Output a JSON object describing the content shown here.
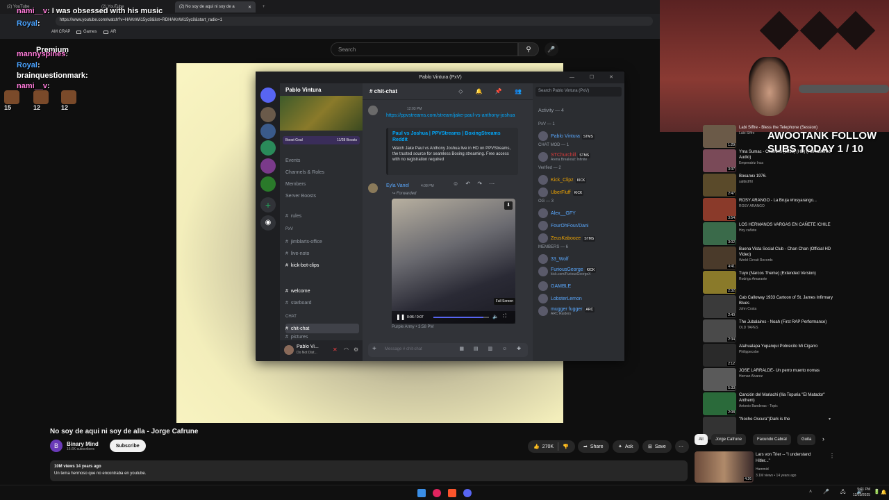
{
  "browser": {
    "tabs": [
      "(2) YouTube",
      "(2) YouTube",
      "(2) No soy de aqui ni soy de a"
    ],
    "url": "https://www.youtube.com/watch?v=HAKnWi15yc8&list=RDHAKnWi15yc8&start_radio=1",
    "bookmarks": [
      "AM CRAP",
      "Games",
      "AR"
    ]
  },
  "chat_overlay": [
    {
      "user": "nami__v",
      "text": ": I was obsessed with his music",
      "color": "#ff7ad9"
    },
    {
      "user": "Royal",
      "text": ":",
      "color": "#4aa3ff"
    },
    {
      "user": "",
      "text": "Premium",
      "color": "#fff"
    },
    {
      "user": "mannyspines",
      "text": ":",
      "color": "#ff7ad9"
    },
    {
      "user": "Royal",
      "text": ":",
      "color": "#4aa3ff"
    },
    {
      "user": "brainquestionmark",
      "text": ":",
      "color": "#fff"
    },
    {
      "user": "nami__v",
      "text": ":",
      "color": "#ff7ad9"
    }
  ],
  "chat_counts": [
    "15",
    "12",
    "12"
  ],
  "youtube": {
    "search_placeholder": "Search",
    "title": "No soy de aqui ni soy de alla - Jorge Cafrune",
    "channel": "Binary Mind",
    "subscribers": "15.6K subscribers",
    "subscribe": "Subscribe",
    "likes": "270K",
    "share": "Share",
    "ask": "Ask",
    "save": "Save",
    "views_line": "10M views  14 years ago",
    "description": "Un tema hermoso que no encontraba en youtube.",
    "chips": [
      "All",
      "Jorge Cafrune",
      "Facundo Cabral",
      "Guita"
    ]
  },
  "discord": {
    "window_title": "Pablo Vintura (PxV)",
    "server_name": "Pablo Vintura",
    "boost_goal": "Boost Goal",
    "boosts": "11/28 Boosts",
    "menu": [
      "Events",
      "Channels & Roles",
      "Members",
      "Server Boosts"
    ],
    "rules": "rules",
    "cat_pxv": "PxV",
    "channels_pxv": [
      "jimblarts-office",
      "live-noto",
      "kick-bot-clips"
    ],
    "channels_misc": [
      "welcome",
      "starboard"
    ],
    "cat_chat": "CHAT",
    "channels_chat": [
      "chit-chat",
      "pictures"
    ],
    "user_name": "Pablo Vi...",
    "user_status": "Do Not Dist...",
    "chat_channel": "chit-chat",
    "search_placeholder": "Search Pablo Vintura (PxV)",
    "msg_time": "12:03 PM",
    "msg_link": "https://ppvstreams.com/stream/jake-paul-vs-anthony-joshua",
    "embed_title": "Paul vs Joshua | PPVStreams | BoxingStreams Reddit",
    "embed_body": "Watch Jake Paul vs Anthony Joshua live in HD on PPVStreams, the trusted source for seamless Boxing streaming. Free access with no registration required",
    "msg2_user": "Eyla Vanel",
    "msg2_time": "4:08 PM",
    "forwarded": "Forwarded",
    "video_time": "0:06 / 0:07",
    "tooltip": "Full Screen",
    "source": "Purple Army • 3:58 PM",
    "composer_placeholder": "Message # chit-chat",
    "activity": "Activity — 4",
    "members": [
      {
        "section": "PxV — 1"
      },
      {
        "name": "Pablo Vintura",
        "color": "#5aa9ff",
        "tag": "STMS"
      },
      {
        "section": "CHAT MOD — 1"
      },
      {
        "name": "STChurchill",
        "color": "#e03c3c",
        "tag": "STMS",
        "sub": "Arena Breakout: Infinite"
      },
      {
        "section": "Verified — 2"
      },
      {
        "name": "Kick_Clipz",
        "color": "#f0a500",
        "tag": "KICK"
      },
      {
        "name": "UberFluff",
        "color": "#f0a500",
        "tag": "KICK"
      },
      {
        "section": "OG — 3"
      },
      {
        "name": "Alex__GFY",
        "color": "#5aa9ff"
      },
      {
        "name": "FourOhFour/Dani",
        "color": "#5aa9ff"
      },
      {
        "name": "ZeusKabooze",
        "color": "#f0a500",
        "tag": "STMS"
      },
      {
        "section": "MEMBERS — 6"
      },
      {
        "name": "33_Wolf",
        "color": "#5aa9ff"
      },
      {
        "name": "FuriousGeorge",
        "color": "#5aa9ff",
        "tag": "KICK",
        "sub": "kick.com/FuriousGeorgeX"
      },
      {
        "name": "GAMBLE",
        "color": "#5aa9ff"
      },
      {
        "name": "LobsterLemon",
        "color": "#5aa9ff"
      },
      {
        "name": "mugger fugger",
        "color": "#5aa9ff",
        "tag": "ARC",
        "sub": "ARC Raiders"
      }
    ]
  },
  "sub_goal": "AWOOTANK FOLLOW\nSUBS TODAY 1 / 10",
  "related": [
    {
      "title": "Labi Siffre - Bless the Telephone (Session)",
      "channel": "Labi Siffre",
      "dur": "1:29",
      "color": "#6b5a48"
    },
    {
      "title": "Yma Sumac - Chuncho (1958) (HD) (Remastered Audio)",
      "channel": "Emperatriz Inca",
      "dur": "3:37",
      "color": "#7a4a58"
    },
    {
      "title": "Вокализ 1976.",
      "channel": "saltEdHil",
      "dur": "2:47",
      "color": "#5a4a2a"
    },
    {
      "title": "ROSY ARANGO - La Bruja #rosyarango...",
      "channel": "ROSY ARANGO",
      "dur": "3:54",
      "color": "#8a3a2a"
    },
    {
      "title": "LOS HERMANOS VARGAS EN CAÑETE /CHILE",
      "channel": "Hoy cañete",
      "dur": "3:02",
      "color": "#3a6a4a"
    },
    {
      "title": "Buena Vista Social Club - Chan Chan (Official HD Video)",
      "channel": "World Circuit Records",
      "dur": "4:41",
      "color": "#4a3a2a"
    },
    {
      "title": "Tuyo (Narcos Theme) (Extended Version)",
      "channel": "Rodrigo Amarante",
      "dur": "2:32",
      "color": "#8a7a2a"
    },
    {
      "title": "Cab Calloway 1933 Cartoon of St. James Infirmary Blues",
      "channel": "John Costa",
      "dur": "2:40",
      "color": "#3a3a3a"
    },
    {
      "title": "The Jubalaires - Noah (First RAP Performance)",
      "channel": "OLD TAPES",
      "dur": "2:34",
      "color": "#4a4a4a"
    },
    {
      "title": "Atahualapa Yupanqui Pobrecito Mi Cigarro",
      "channel": "Philippecobe",
      "dur": "2:12",
      "color": "#2a2a2a"
    },
    {
      "title": "JOSE LARRALDE- Un perro muerto nomas",
      "channel": "Hernan Alvarez",
      "dur": "5:33",
      "color": "#5a5a5a"
    },
    {
      "title": "Canción del Mariachi (Ilia Topuria \"El Matador\" Anthem)",
      "channel": "Antonio Banderas - Topic",
      "dur": "2:08",
      "color": "#2a6a3a"
    },
    {
      "title": "\"Noche Oscura\"(Dark is the",
      "channel": "",
      "dur": "",
      "color": "#333"
    }
  ],
  "bottom_video": {
    "title": "Lars von Trier -- \"I understand Hitler...\"",
    "channel": "Hammid",
    "meta": "3.1M views • 14 years ago",
    "dur": "4:26"
  },
  "clock": {
    "time": "5:01 PM",
    "date": "12/20/2025"
  }
}
